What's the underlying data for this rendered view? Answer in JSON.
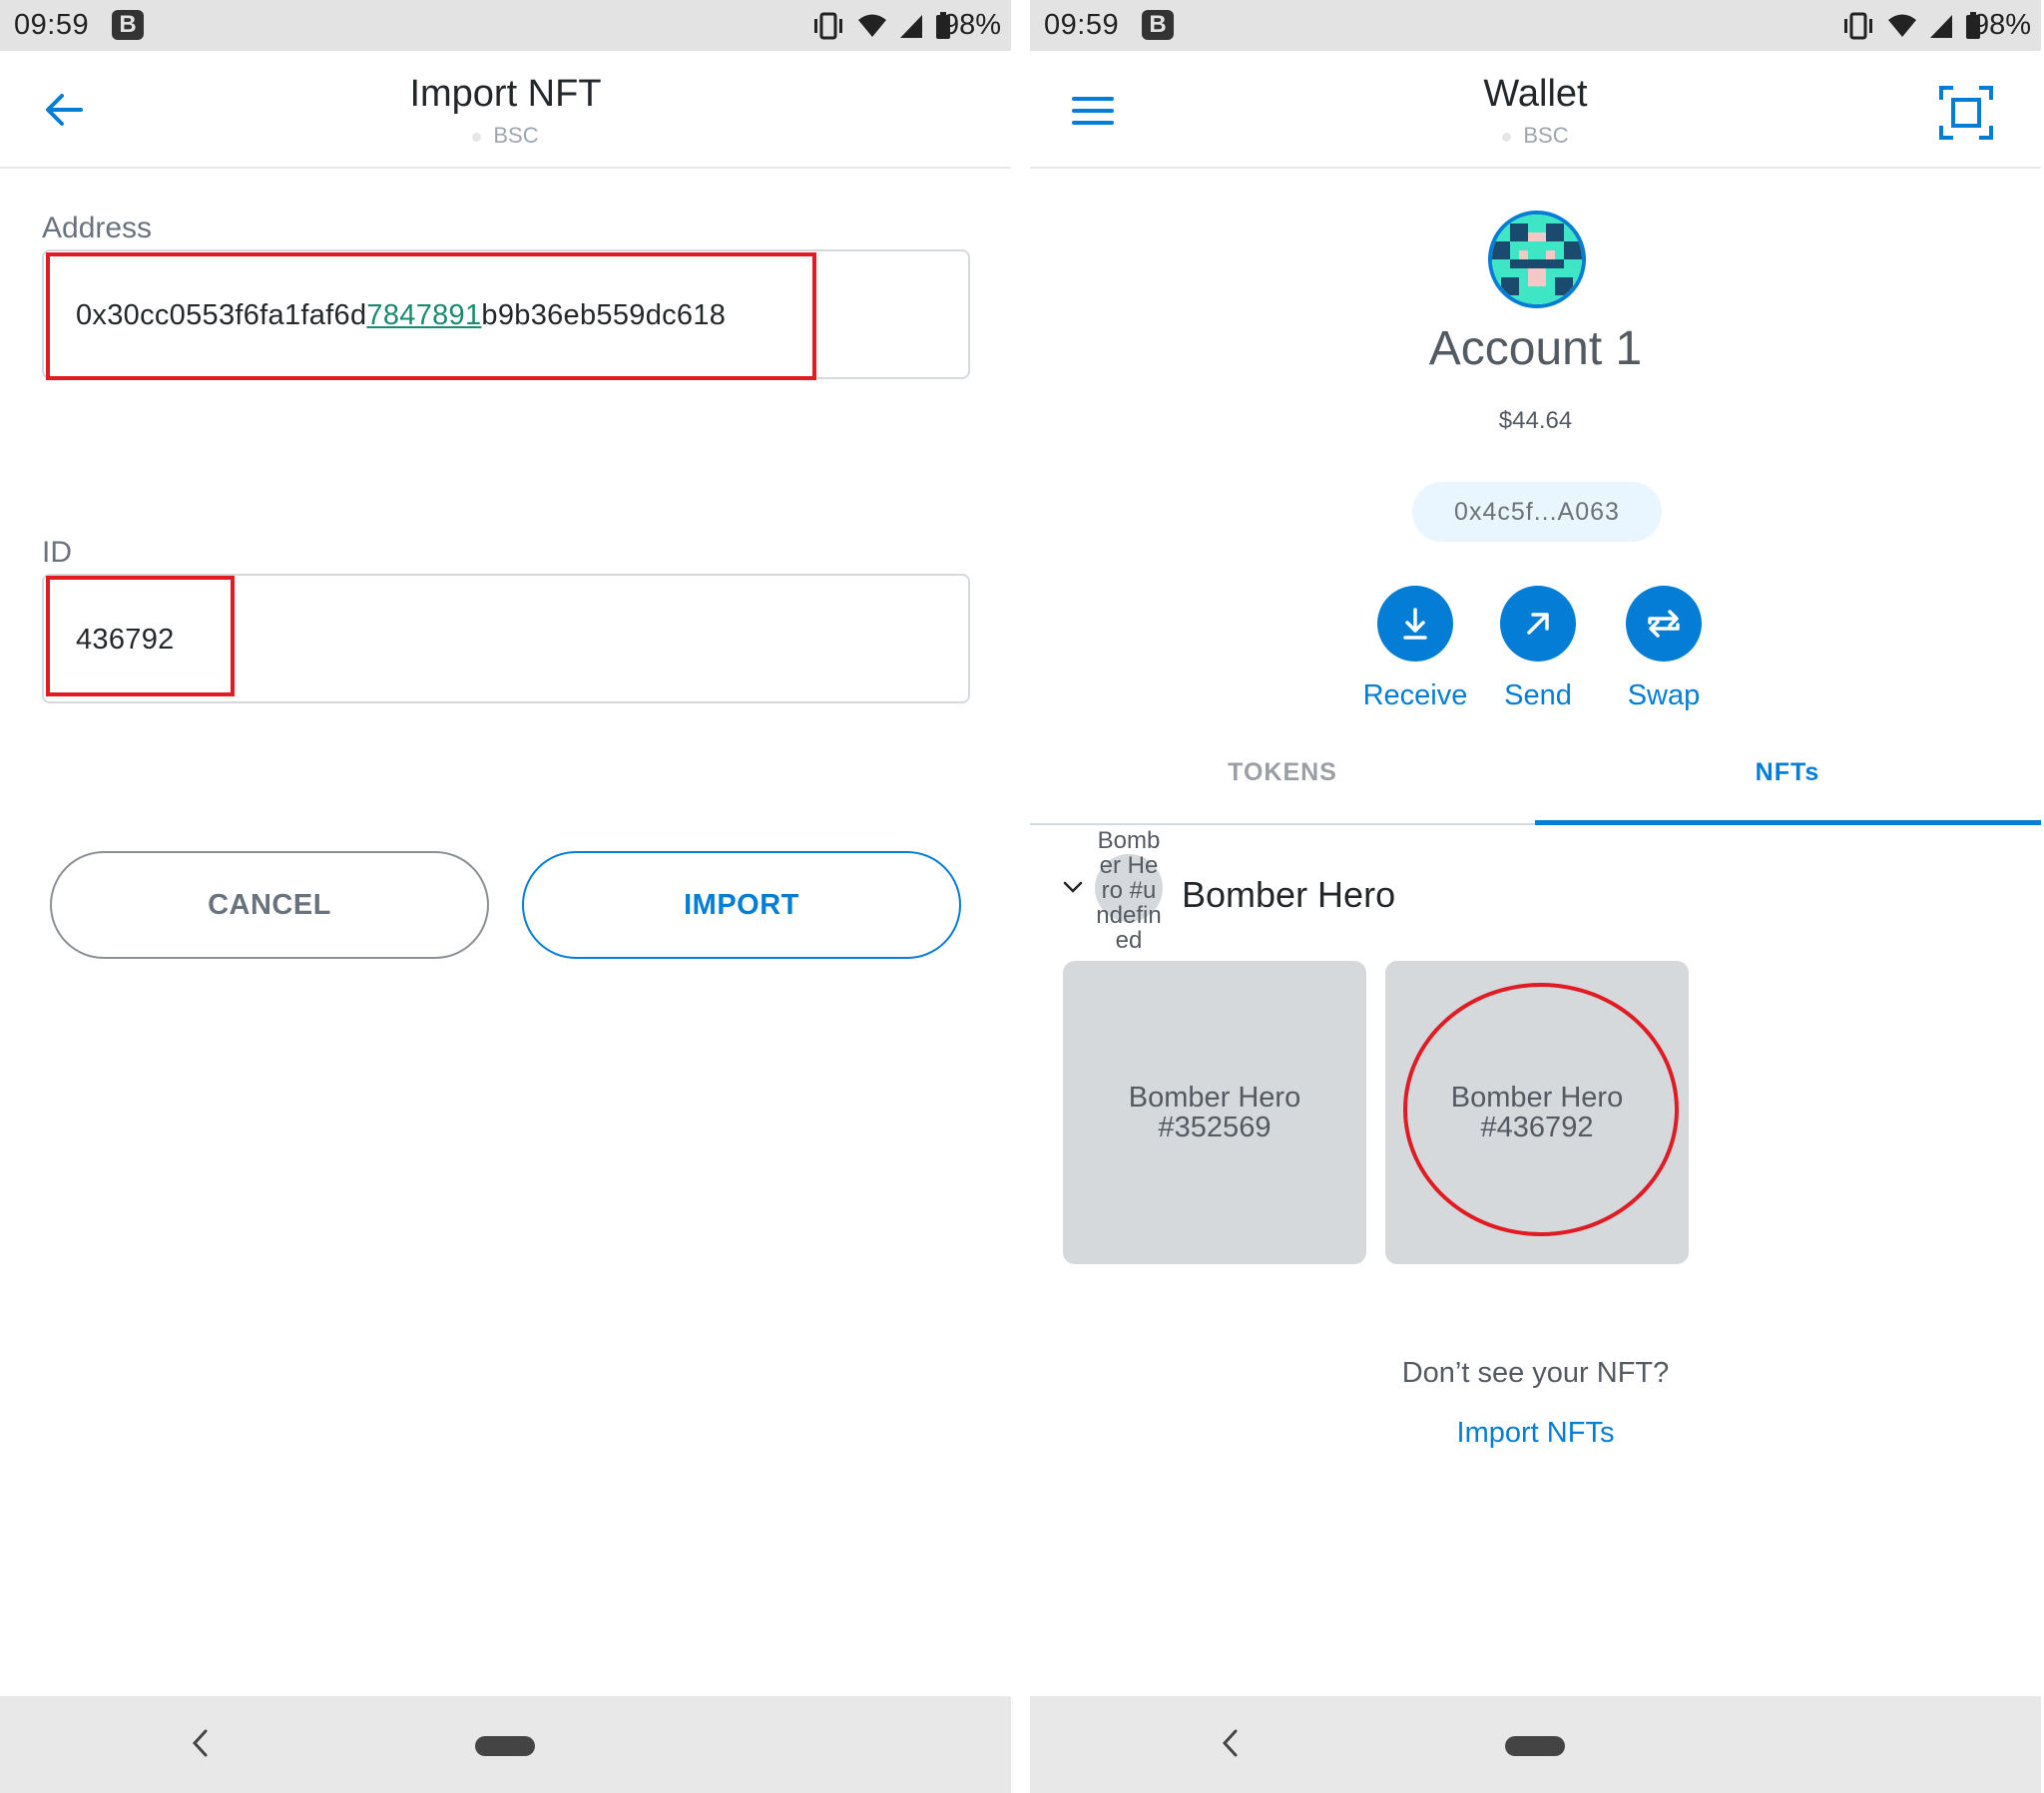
{
  "left_screen": {
    "status_bar": {
      "time": "09:59",
      "badge": "B",
      "battery": "98%"
    },
    "header": {
      "title": "Import NFT",
      "network": "BSC"
    },
    "address_field": {
      "label": "Address",
      "value_before": "0x30cc0553f6fa1faf6d",
      "value_highlight": "7847891",
      "value_after": "b9b36eb559dc618"
    },
    "id_field": {
      "label": "ID",
      "value": "436792"
    },
    "buttons": {
      "cancel": "CANCEL",
      "import": "IMPORT"
    }
  },
  "right_screen": {
    "status_bar": {
      "time": "09:59",
      "badge": "B",
      "battery": "98%"
    },
    "header": {
      "title": "Wallet",
      "network": "BSC"
    },
    "account": {
      "name": "Account 1",
      "balance": "$44.64",
      "address_short": "0x4c5f...A063"
    },
    "actions": [
      {
        "label": "Receive",
        "icon": "download-arrow-icon"
      },
      {
        "label": "Send",
        "icon": "arrow-up-right-icon"
      },
      {
        "label": "Swap",
        "icon": "swap-arrows-icon"
      }
    ],
    "tabs": [
      {
        "label": "TOKENS",
        "active": false
      },
      {
        "label": "NFTs",
        "active": true
      }
    ],
    "collection": {
      "name": "Bomber Hero",
      "thumbnail_alt": "Bomber Hero #undefined",
      "items": [
        {
          "title": "Bomber Hero",
          "id": "#352569"
        },
        {
          "title": "Bomber Hero",
          "id": "#436792"
        }
      ]
    },
    "footer": {
      "prompt": "Don’t see your NFT?",
      "link": "Import NFTs"
    }
  },
  "colors": {
    "accent": "#037dd6",
    "annotation": "#e01b24",
    "card": "#d6d9dc"
  }
}
